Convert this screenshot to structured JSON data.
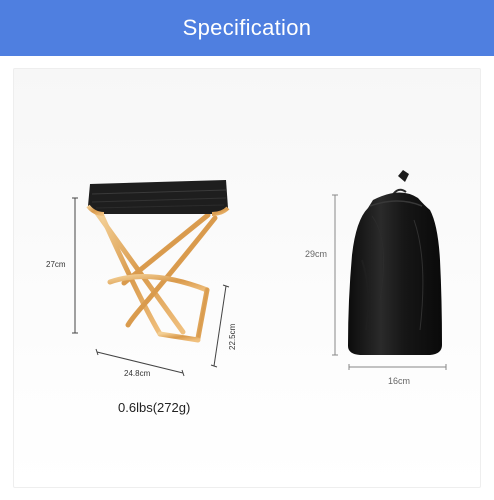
{
  "header": {
    "title": "Specification"
  },
  "stool": {
    "height_label": "27cm",
    "width_label": "24.8cm",
    "depth_label": "22.5cm",
    "weight_label": "0.6lbs(272g)",
    "frame_color": "#e6b16a",
    "seat_color": "#1e1e1e"
  },
  "bag": {
    "height_label": "29cm",
    "width_label": "16cm",
    "bag_color": "#151515"
  },
  "colors": {
    "banner": "#4f7fe0"
  }
}
